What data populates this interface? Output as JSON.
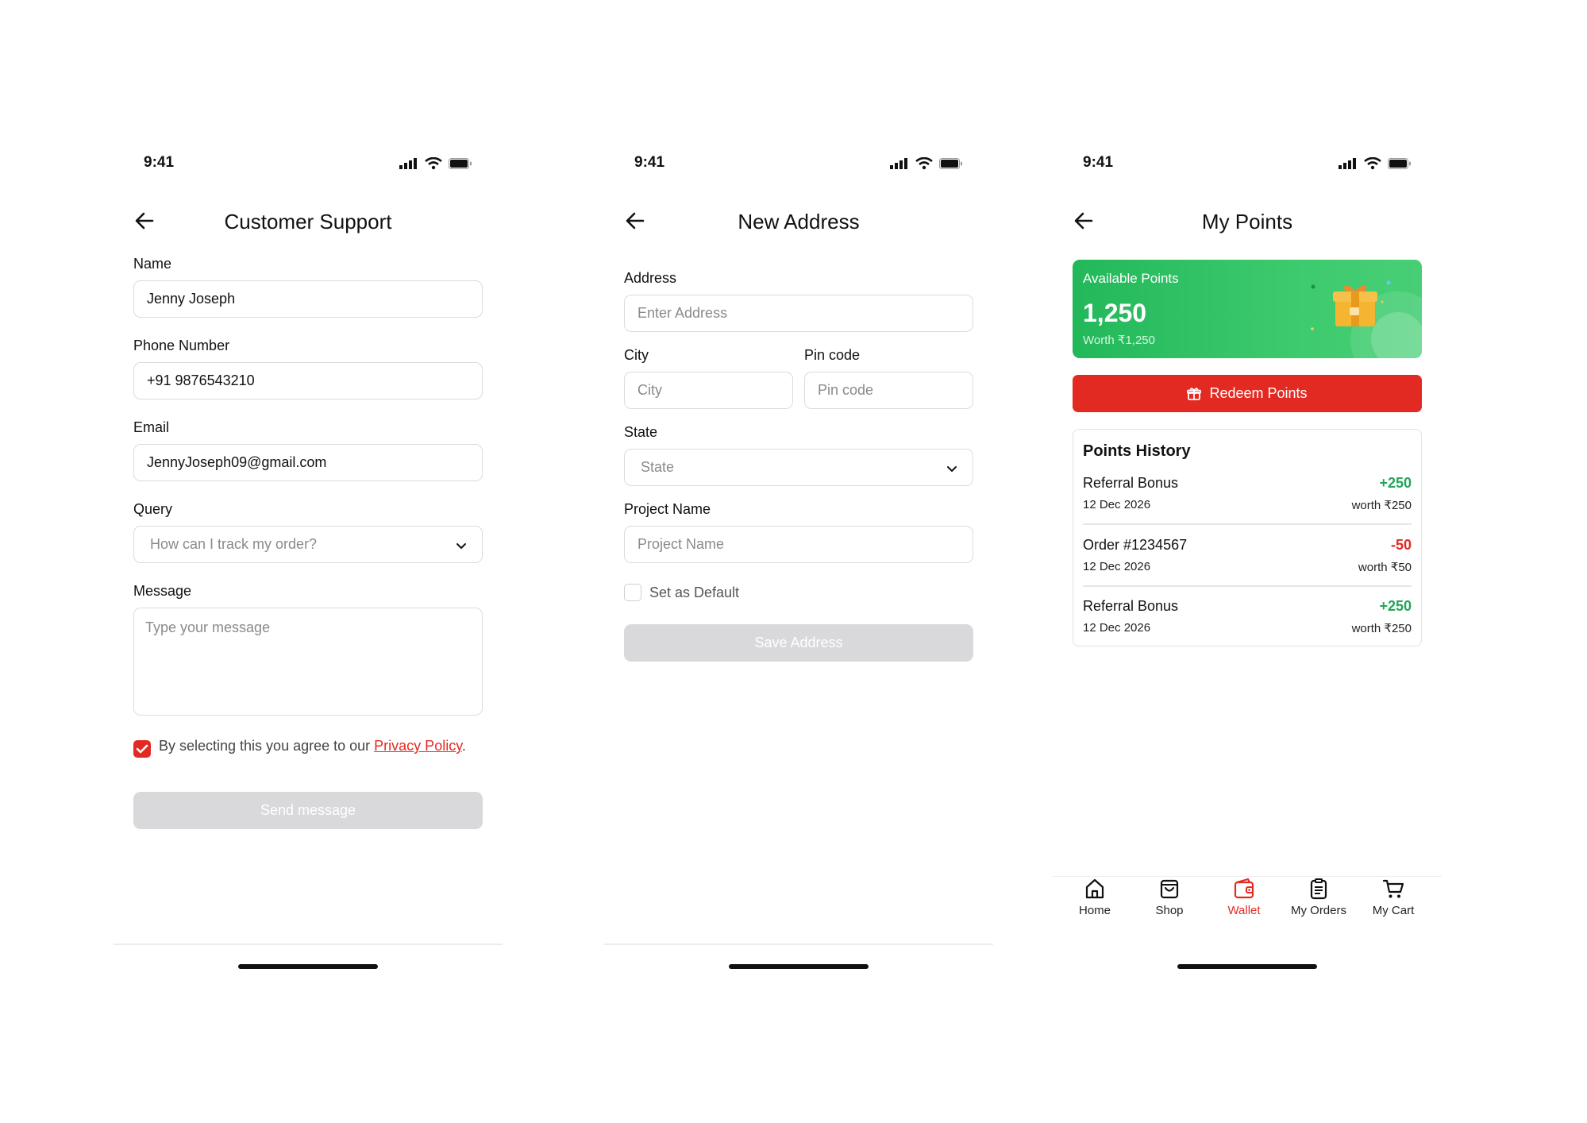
{
  "status": {
    "time": "9:41"
  },
  "support": {
    "title": "Customer Support",
    "name_label": "Name",
    "name_value": "Jenny Joseph",
    "phone_label": "Phone Number",
    "phone_value": "+91 9876543210",
    "email_label": "Email",
    "email_value": "JennyJoseph09@gmail.com",
    "query_label": "Query",
    "query_value": "How can I track my order?",
    "message_label": "Message",
    "message_placeholder": "Type your message",
    "consent_text": "By selecting this you agree to our",
    "consent_link": "Privacy Policy",
    "consent_end": ".",
    "send_label": "Send message"
  },
  "address": {
    "title": "New Address",
    "address_label": "Address",
    "address_placeholder": "Enter Address",
    "city_label": "City",
    "city_placeholder": "City",
    "pin_label": "Pin code",
    "pin_placeholder": "Pin code",
    "state_label": "State",
    "state_placeholder": "State",
    "project_label": "Project Name",
    "project_placeholder": "Project Name",
    "default_label": "Set as Default",
    "save_label": "Save Address"
  },
  "points": {
    "title": "My Points",
    "card_label": "Available Points",
    "card_value": "1,250",
    "card_worth": "Worth ₹1,250",
    "redeem_label": "Redeem Points",
    "history_title": "Points History",
    "history": [
      {
        "name": "Referral Bonus",
        "date": "12 Dec 2026",
        "points": "+250",
        "worth": "worth ₹250",
        "kind": "credit"
      },
      {
        "name": "Order #1234567",
        "date": "12 Dec 2026",
        "points": "-50",
        "worth": "worth ₹50",
        "kind": "debit"
      },
      {
        "name": "Referral Bonus",
        "date": "12 Dec 2026",
        "points": "+250",
        "worth": "worth ₹250",
        "kind": "credit"
      }
    ],
    "nav": [
      {
        "label": "Home",
        "icon": "home-icon",
        "active": false
      },
      {
        "label": "Shop",
        "icon": "shopping-bag-icon",
        "active": false
      },
      {
        "label": "Wallet",
        "icon": "wallet-icon",
        "active": true
      },
      {
        "label": "My Orders",
        "icon": "clipboard-icon",
        "active": false
      },
      {
        "label": "My Cart",
        "icon": "cart-icon",
        "active": false
      }
    ]
  },
  "colors": {
    "accent": "#e22a23",
    "credit": "#23a55a",
    "debit": "#e22a23",
    "card_green": "#34c163",
    "disabled": "#d9d9dc"
  }
}
